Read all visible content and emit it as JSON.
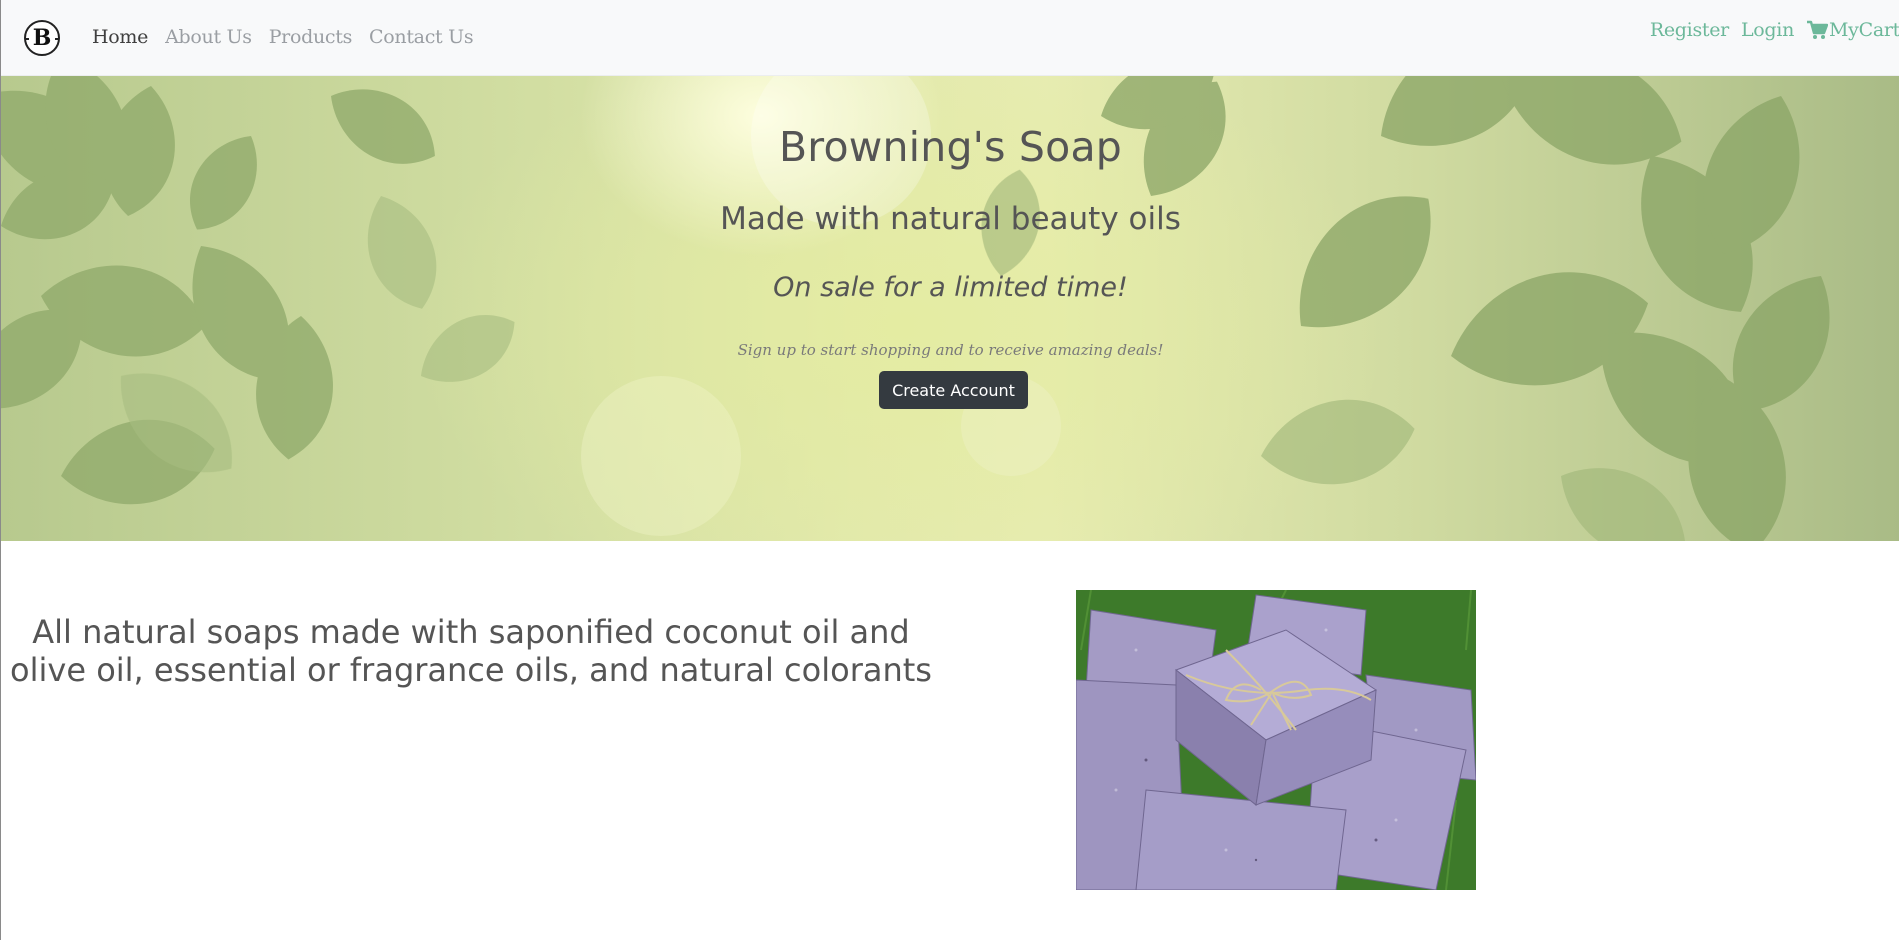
{
  "brand": {
    "logo_letter": "B"
  },
  "nav": {
    "links": [
      {
        "label": "Home",
        "active": true
      },
      {
        "label": "About Us",
        "active": false
      },
      {
        "label": "Products",
        "active": false
      },
      {
        "label": "Contact Us",
        "active": false
      }
    ],
    "register": "Register",
    "login": "Login",
    "cart": "MyCart",
    "accent_color": "#6cb89a"
  },
  "hero": {
    "title": "Browning's Soap",
    "subtitle": "Made with natural beauty oils",
    "promo": "On sale for a limited time!",
    "signup_text": "Sign up to start shopping and to receive amazing deals!",
    "cta_label": "Create Account"
  },
  "content": {
    "lead": "All natural soaps made with saponified coconut oil and olive oil, essential or fragrance oils, and natural colorants"
  },
  "icons": [
    "cart-icon"
  ]
}
